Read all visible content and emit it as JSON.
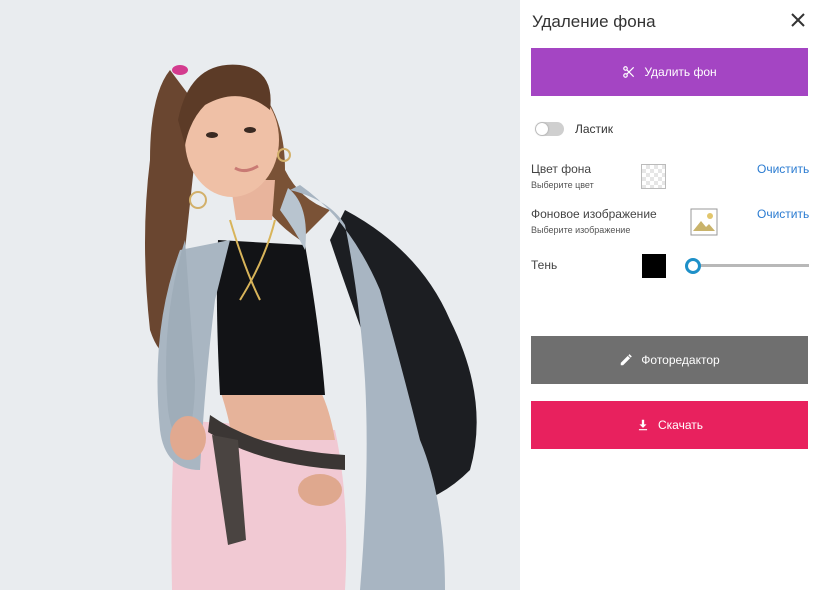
{
  "panel": {
    "title": "Удаление фона",
    "remove_bg_label": "Удалить фон",
    "eraser_label": "Ластик",
    "eraser_on": false,
    "bg_color": {
      "title": "Цвет фона",
      "subtitle": "Выберите цвет",
      "clear_label": "Очистить"
    },
    "bg_image": {
      "title": "Фоновое изображение",
      "subtitle": "Выберите изображение",
      "clear_label": "Очистить"
    },
    "shadow": {
      "title": "Тень",
      "color": "#000000",
      "value": 0
    },
    "editor_label": "Фоторедактор",
    "download_label": "Скачать"
  },
  "colors": {
    "remove_button": "#a445c3",
    "editor_button": "#6f6f6f",
    "download_button": "#e8215e",
    "link": "#2a7bd1",
    "slider_thumb": "#1e90c8",
    "canvas_bg": "#e9ecef"
  },
  "icons": {
    "remove": "scissors-icon",
    "editor": "pencil-icon",
    "download": "download-icon",
    "close": "close-icon",
    "bg_image": "image-icon"
  }
}
